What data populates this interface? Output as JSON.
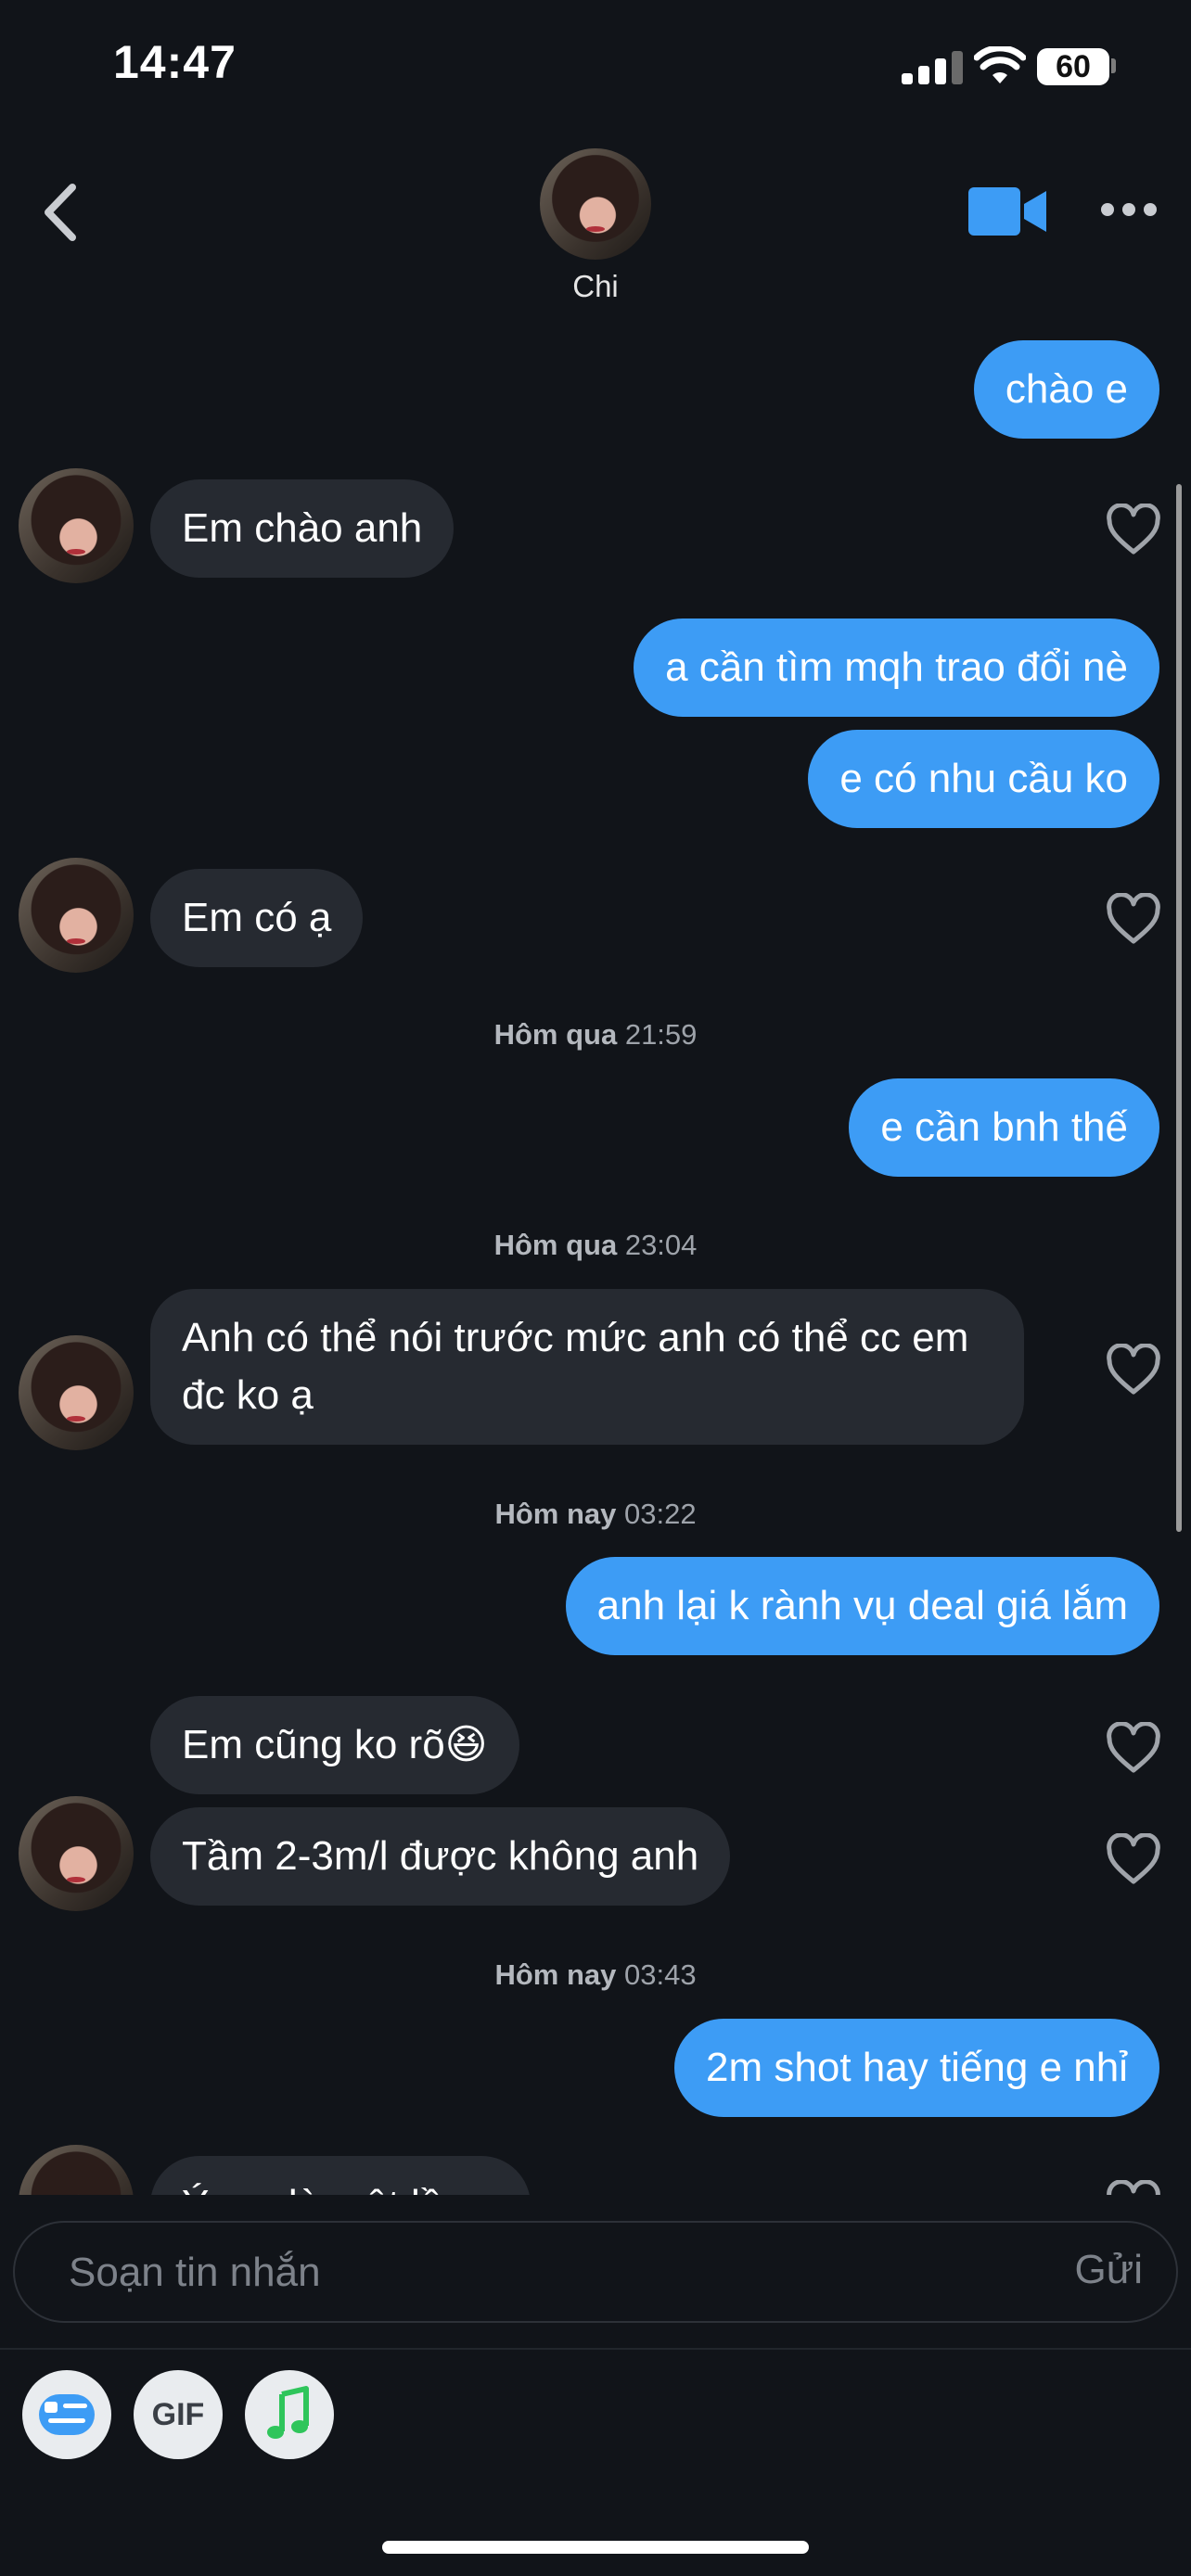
{
  "status_bar": {
    "time": "14:47",
    "battery": "60"
  },
  "header": {
    "contact_name": "Chi"
  },
  "messages": [
    {
      "text": "chào e"
    },
    {
      "text": "Em chào anh"
    },
    {
      "text": "a cần tìm mqh trao đổi nè"
    },
    {
      "text": "e có nhu cầu ko"
    },
    {
      "text": "Em có ạ"
    },
    {
      "ts_day": "Hôm qua",
      "ts_time": "21:59"
    },
    {
      "text": "e cần bnh thế"
    },
    {
      "ts_day": "Hôm qua",
      "ts_time": "23:04"
    },
    {
      "text": "Anh có thể nói trước mức anh có thể cc em đc ko ạ"
    },
    {
      "ts_day": "Hôm nay",
      "ts_time": "03:22"
    },
    {
      "text": "anh lại k rành vụ deal giá lắm"
    },
    {
      "text": "Em cũng ko rõ😆"
    },
    {
      "text": "Tầm 2-3m/l được không anh"
    },
    {
      "ts_day": "Hôm nay",
      "ts_time": "03:43"
    },
    {
      "text": "2m shot hay tiếng e nhỉ"
    },
    {
      "text": "Ý em là một lần ạ"
    }
  ],
  "composer": {
    "placeholder": "Soạn tin nhắn",
    "send_label": "Gửi"
  },
  "toolbar": {
    "gif_label": "GIF"
  },
  "colors": {
    "outgoing_bubble": "#3d9cf5",
    "incoming_bubble": "#262a31",
    "background": "#111419",
    "video_icon": "#3d9cf5",
    "music_icon": "#2fc55b"
  },
  "icons": [
    "back-chevron-icon",
    "video-call-icon",
    "more-icon",
    "heart-icon",
    "sticker-icon",
    "gif-icon",
    "music-icon"
  ]
}
